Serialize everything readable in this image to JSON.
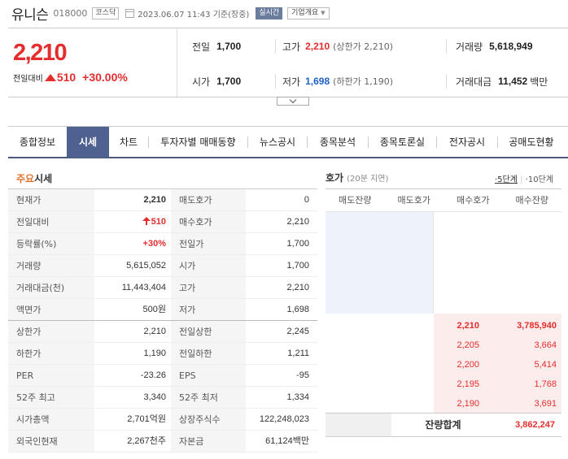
{
  "header": {
    "name": "유니슨",
    "code": "018000",
    "market": "코스닥",
    "datetime": "2023.06.07 11:43 기준(장중)",
    "live": "실시간",
    "company_info": "기업개요"
  },
  "summary": {
    "price": "2,210",
    "change_label": "전일대비",
    "change": "510",
    "change_pct": "+30.00%",
    "prev_close_label": "전일",
    "prev_close": "1,700",
    "open_label": "시가",
    "open": "1,700",
    "high_label": "고가",
    "high": "2,210",
    "high_sub": "(상한가 2,210)",
    "low_label": "저가",
    "low": "1,698",
    "low_sub": "(하한가 1,190)",
    "volume_label": "거래량",
    "volume": "5,618,949",
    "amount_label": "거래대금",
    "amount": "11,452",
    "amount_unit": "백만"
  },
  "tabs": [
    "종합정보",
    "시세",
    "차트",
    "투자자별 매매동향",
    "뉴스공시",
    "종목분석",
    "종목토론실",
    "전자공시",
    "공매도현황"
  ],
  "main_quote": {
    "title_a": "주요",
    "title_b": "시세",
    "rows": [
      [
        "현재가",
        "2,210",
        "매도호가",
        "0"
      ],
      [
        "전일대비",
        "510",
        "매수호가",
        "2,210"
      ],
      [
        "등락률(%)",
        "+30%",
        "전일가",
        "1,700"
      ],
      [
        "거래량",
        "5,615,052",
        "시가",
        "1,700"
      ],
      [
        "거래대금(천)",
        "11,443,404",
        "고가",
        "2,210"
      ],
      [
        "액면가",
        "500원",
        "저가",
        "1,698"
      ],
      [
        "상한가",
        "2,210",
        "전일상한",
        "2,245"
      ],
      [
        "하한가",
        "1,190",
        "전일하한",
        "1,211"
      ],
      [
        "PER",
        "-23.26",
        "EPS",
        "-95"
      ],
      [
        "52주 최고",
        "3,340",
        "52주 최저",
        "1,334"
      ],
      [
        "시가총액",
        "2,701억원",
        "상장주식수",
        "122,248,023"
      ],
      [
        "외국인현재",
        "2,267천주",
        "자본금",
        "61,124백만"
      ]
    ]
  },
  "orderbook": {
    "title": "호가",
    "delay": "(20분 지연)",
    "opt_5": "5단계",
    "opt_10": "10단계",
    "columns": [
      "매도잔량",
      "매도호가",
      "매수호가",
      "매수잔량"
    ],
    "bids": [
      [
        "2,210",
        "3,785,940"
      ],
      [
        "2,205",
        "3,664"
      ],
      [
        "2,200",
        "5,414"
      ],
      [
        "2,195",
        "1,768"
      ],
      [
        "2,190",
        "3,691"
      ]
    ],
    "total_label": "잔량합계",
    "total": "3,862,247"
  },
  "colors": {
    "up": "#e52d2d",
    "down": "#2060c8",
    "tab_active": "#4e6190"
  }
}
